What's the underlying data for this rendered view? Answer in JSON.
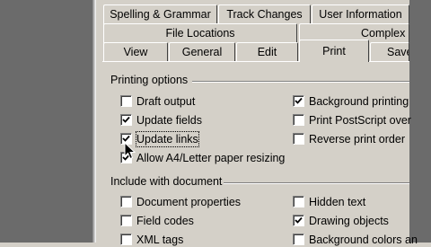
{
  "tabs_row1": [
    "Spelling & Grammar",
    "Track Changes",
    "User Information"
  ],
  "tabs_row2": [
    "File Locations",
    "Complex S"
  ],
  "tabs_row3": [
    "View",
    "General",
    "Edit",
    "Print",
    "Save"
  ],
  "active_tab": "Print",
  "printing_options": {
    "label": "Printing options",
    "left": [
      {
        "label": "Draft output",
        "checked": false
      },
      {
        "label": "Update fields",
        "checked": true
      },
      {
        "label": "Update links",
        "checked": true
      },
      {
        "label": "Allow A4/Letter paper resizing",
        "checked": true
      }
    ],
    "right": [
      {
        "label": "Background printing",
        "checked": true
      },
      {
        "label": "Print PostScript over",
        "checked": false
      },
      {
        "label": "Reverse print order",
        "checked": false
      }
    ]
  },
  "include_with_document": {
    "label": "Include with document",
    "left": [
      {
        "label": "Document properties",
        "checked": false
      },
      {
        "label": "Field codes",
        "checked": false
      },
      {
        "label": "XML tags",
        "checked": false
      }
    ],
    "right": [
      {
        "label": "Hidden text",
        "checked": false
      },
      {
        "label": "Drawing objects",
        "checked": true
      },
      {
        "label": "Background colors an",
        "checked": false
      }
    ]
  }
}
